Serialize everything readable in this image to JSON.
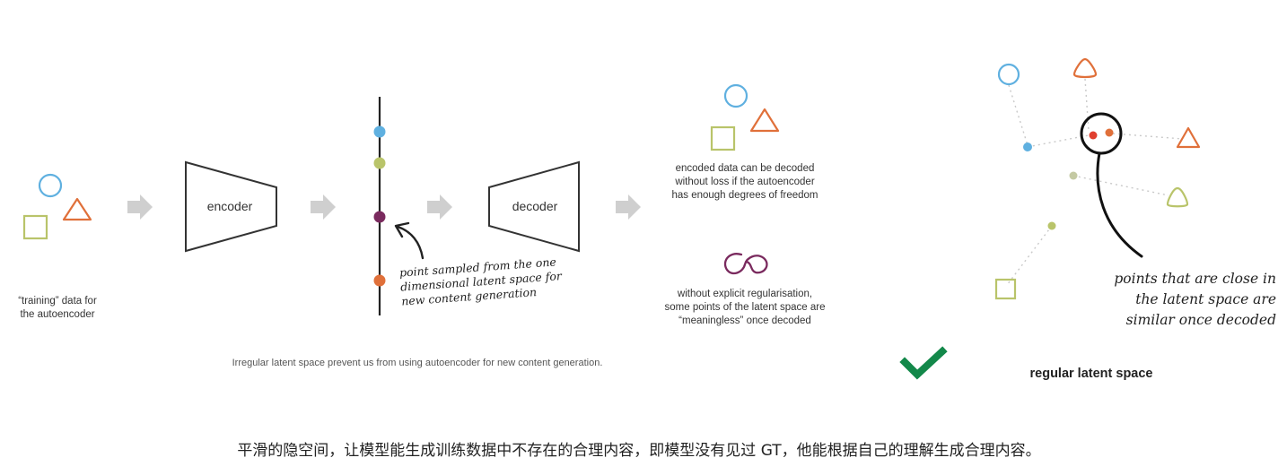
{
  "labels": {
    "training_data": "“training” data for the autoencoder",
    "encoder": "encoder",
    "decoder": "decoder",
    "sampled_note": "point sampled from the one dimensional latent space for new content generation",
    "lossless_note": "encoded data can be decoded without loss if the autoencoder has enough degrees of freedom",
    "meaningless_note": "without explicit regularisation, some points of the latent space are “meaningless” once decoded",
    "irregular_caption": "Irregular latent space prevent us from using autoencoder for new content generation.",
    "close_note": "points that are close in the latent space are similar once decoded",
    "regular_title": "regular latent space",
    "chinese_caption": "平滑的隐空间，让模型能生成训练数据中不存在的合理内容，即模型没有见过 GT，他能根据自己的理解生成合理内容。"
  },
  "colors": {
    "blue": "#5fb0e0",
    "orange": "#e0703a",
    "green": "#b9c46a",
    "purple": "#7a2a5e",
    "arrow_gray": "#cfcfcf",
    "check_green": "#13884a"
  },
  "icons": [
    "circle-icon",
    "triangle-icon",
    "square-icon",
    "arrow-right-icon",
    "checkmark-icon",
    "scribble-icon"
  ]
}
